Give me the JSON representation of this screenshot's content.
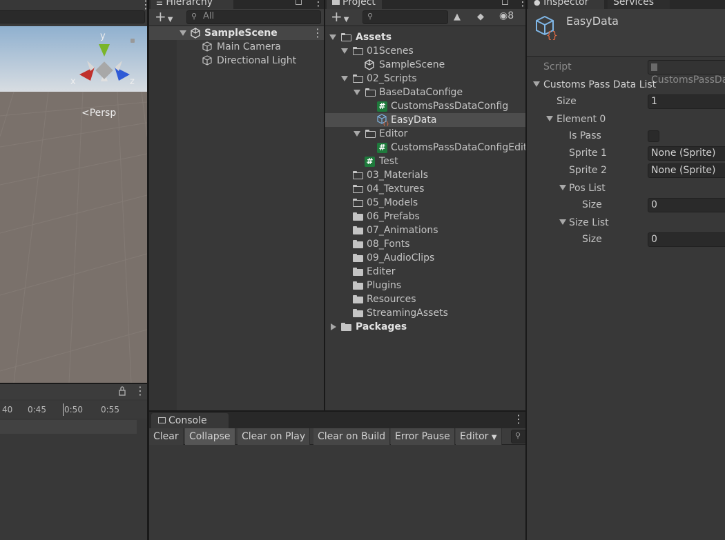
{
  "scene": {
    "gizmo_axis_x": "x",
    "gizmo_axis_y": "y",
    "gizmo_axis_z": "z",
    "persp_label": "Persp",
    "gizmo_colors": {
      "x": "#c0302c",
      "y": "#7ab52a",
      "z": "#2e5ad6"
    }
  },
  "timeline": {
    "ticks": [
      "40",
      "0:45",
      "0:50",
      "0:55"
    ]
  },
  "hierarchy": {
    "tab_label": "Hierarchy",
    "search_placeholder": "All",
    "scene_name": "SampleScene",
    "objects": [
      {
        "label": "Main Camera",
        "icon": "cube-icon"
      },
      {
        "label": "Directional Light",
        "icon": "cube-icon"
      }
    ]
  },
  "project": {
    "tab_label": "Project",
    "hidden_count": "8",
    "tree": {
      "assets": "Assets",
      "scenes_folder": "01Scenes",
      "scene_file": "SampleScene",
      "scripts_folder": "02_Scripts",
      "base_folder": "BaseDataConfige",
      "config_script": "CustomsPassDataConfig",
      "easydata_asset": "EasyData",
      "editor_folder": "Editor",
      "editor_script": "CustomsPassDataConfigEditor",
      "test_script": "Test",
      "folders": [
        "03_Materials",
        "04_Textures",
        "05_Models",
        "06_Prefabs",
        "07_Animations",
        "08_Fonts",
        "09_AudioClips",
        "Editer",
        "Plugins",
        "Resources",
        "StreamingAssets"
      ],
      "packages": "Packages"
    }
  },
  "console": {
    "tab_label": "Console",
    "buttons": {
      "clear": "Clear",
      "collapse": "Collapse",
      "clear_on_play": "Clear on Play",
      "clear_on_build": "Clear on Build",
      "error_pause": "Error Pause",
      "editor": "Editor"
    }
  },
  "inspector": {
    "tab_label": "Inspector",
    "services_tab": "Services",
    "asset_name": "EasyData",
    "script_label": "Script",
    "script_value": "CustomsPassDataConfig",
    "list_label": "Customs Pass Data List",
    "size_label": "Size",
    "size_value": "1",
    "element_label": "Element 0",
    "is_pass_label": "Is Pass",
    "sprite1_label": "Sprite 1",
    "sprite1_value": "None (Sprite)",
    "sprite2_label": "Sprite 2",
    "sprite2_value": "None (Sprite)",
    "pos_list_label": "Pos List",
    "pos_size_label": "Size",
    "pos_size_value": "0",
    "size_list_label": "Size List",
    "size_size_label": "Size",
    "size_size_value": "0"
  }
}
